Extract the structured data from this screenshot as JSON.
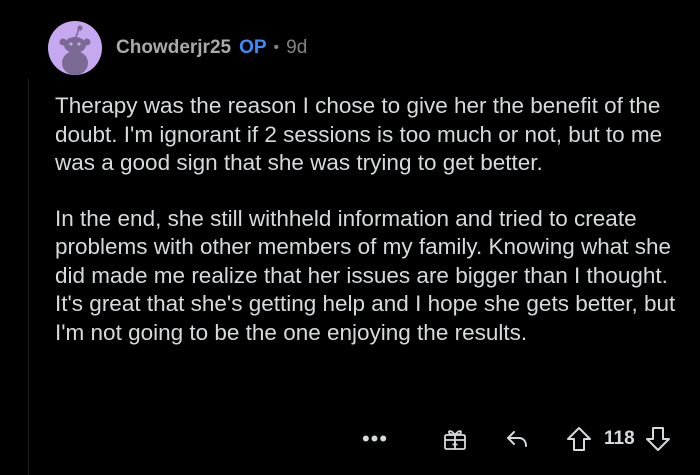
{
  "comment": {
    "username": "Chowderjr25",
    "op_badge": "OP",
    "separator": "•",
    "age": "9d",
    "paragraphs": [
      "Therapy was the reason I chose to give her the benefit of the doubt. I'm ignorant if 2 sessions is too much or not, but to me was a good sign that she was trying to get better.",
      "In the end, she still withheld information and tried to create problems with other members of my family. Knowing what she did made me realize that her issues are bigger than I thought. It's great that she's getting help and I hope she gets better, but I'm not going to be the one enjoying the results."
    ],
    "score": "118"
  },
  "actions": {
    "more_label": "•••",
    "icons": [
      "more-options-icon",
      "award-icon",
      "reply-icon",
      "upvote-icon",
      "downvote-icon"
    ]
  },
  "colors": {
    "background": "#000000",
    "text": "#d7dadc",
    "meta": "#818384",
    "username": "#a8aaab",
    "op": "#3d8bff",
    "avatar_bg": "#c6a8f0"
  }
}
